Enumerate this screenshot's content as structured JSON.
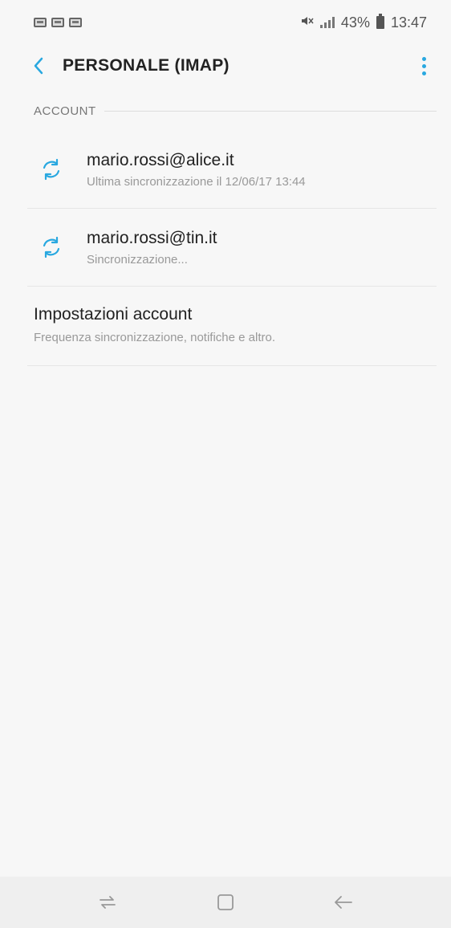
{
  "status_bar": {
    "battery": "43%",
    "time": "13:47"
  },
  "app_bar": {
    "title": "PERSONALE (IMAP)"
  },
  "section": {
    "label": "ACCOUNT"
  },
  "accounts": [
    {
      "email": "mario.rossi@alice.it",
      "status": "Ultima sincronizzazione il 12/06/17  13:44"
    },
    {
      "email": "mario.rossi@tin.it",
      "status": "Sincronizzazione..."
    }
  ],
  "settings": {
    "title": "Impostazioni account",
    "subtitle": "Frequenza sincronizzazione, notifiche e altro."
  },
  "colors": {
    "accent": "#29a8e0",
    "background": "#f7f7f7"
  },
  "icons": {
    "back": "chevron-left-icon",
    "more": "more-vertical-icon",
    "sync": "sync-icon",
    "nav_recent": "recent-apps-icon",
    "nav_home": "home-icon",
    "nav_back": "back-arrow-icon"
  }
}
